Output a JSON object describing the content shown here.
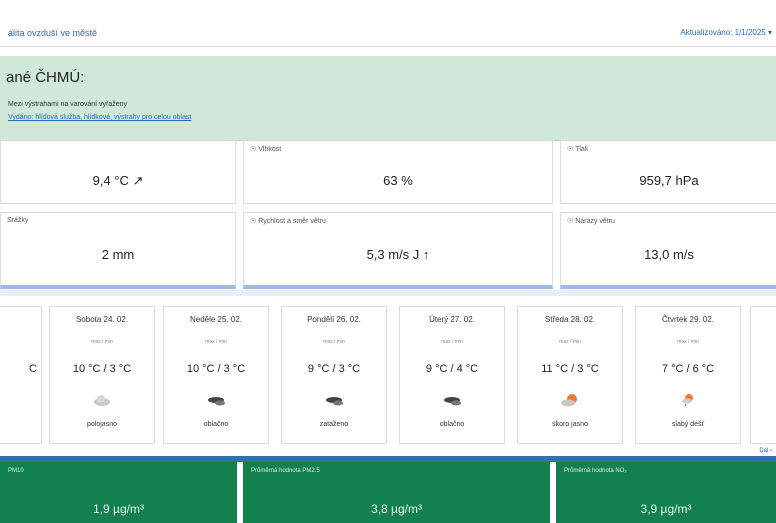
{
  "header": {
    "left_link": "álita ovzduší ve městě",
    "right_link": "Aktualizováno: 1/1/2025 ▾"
  },
  "notice": {
    "title": "ané ČHMÚ:",
    "line1": "Mezi výstrahami na varování vyřaženy",
    "link": "Vydáno: hlídová služba, hlídkové, výstrahy pro celou oblast"
  },
  "tiles": [
    {
      "label": "",
      "value": "9,4 °C ↗"
    },
    {
      "label": "☉ Vlhkost",
      "value": "63 %"
    },
    {
      "label": "☉ Tlak",
      "value": "959,7 hPa"
    },
    {
      "label": "Srážky",
      "value": "2 mm"
    },
    {
      "label": "☉ Rychlost a směr větru",
      "value": "5,3 m/s J ↑"
    },
    {
      "label": "☉ Nárazy větru",
      "value": "13,0 m/s"
    }
  ],
  "forecast": {
    "days": [
      {
        "name": "",
        "sub": "",
        "temp": "C",
        "icon": "",
        "desc": ""
      },
      {
        "name": "Sobota 24. 02.",
        "sub": "max / min",
        "temp": "10 °C / 3 °C",
        "icon": "cloud-icon",
        "desc": "polojasno"
      },
      {
        "name": "Neděle 25. 02.",
        "sub": "max / min",
        "temp": "10 °C / 3 °C",
        "icon": "cloud-dark-icon",
        "desc": "oblačno"
      },
      {
        "name": "Pondělí 26. 02.",
        "sub": "max / min",
        "temp": "9 °C / 3 °C",
        "icon": "cloud-dark-icon",
        "desc": "zataženo"
      },
      {
        "name": "Úterý 27. 02.",
        "sub": "max / min",
        "temp": "9 °C / 4 °C",
        "icon": "cloud-dark-icon",
        "desc": "oblačno"
      },
      {
        "name": "Středa 28. 02.",
        "sub": "max / min",
        "temp": "11 °C / 3 °C",
        "icon": "sun-cloud-icon",
        "desc": "skoro jasno"
      },
      {
        "name": "Čtvrtek 29. 02.",
        "sub": "max / min",
        "temp": "7 °C / 6 °C",
        "icon": "sun-rain-icon",
        "desc": "slabý déšť"
      }
    ],
    "more_link": "Dál ›"
  },
  "air_quality": [
    {
      "label": "PM10",
      "value": "1,9 µg/m³"
    },
    {
      "label": "Průměrná hodnota PM2.5",
      "value": "3,8 µg/m³"
    },
    {
      "label": "Průměrná hodnota NO₂",
      "value": "3,9 µg/m³"
    }
  ],
  "colors": {
    "notice_bg": "#cfe8d9",
    "link": "#2b6cb0",
    "aq_good": "#138050",
    "accent_line": "#2f70b6"
  }
}
